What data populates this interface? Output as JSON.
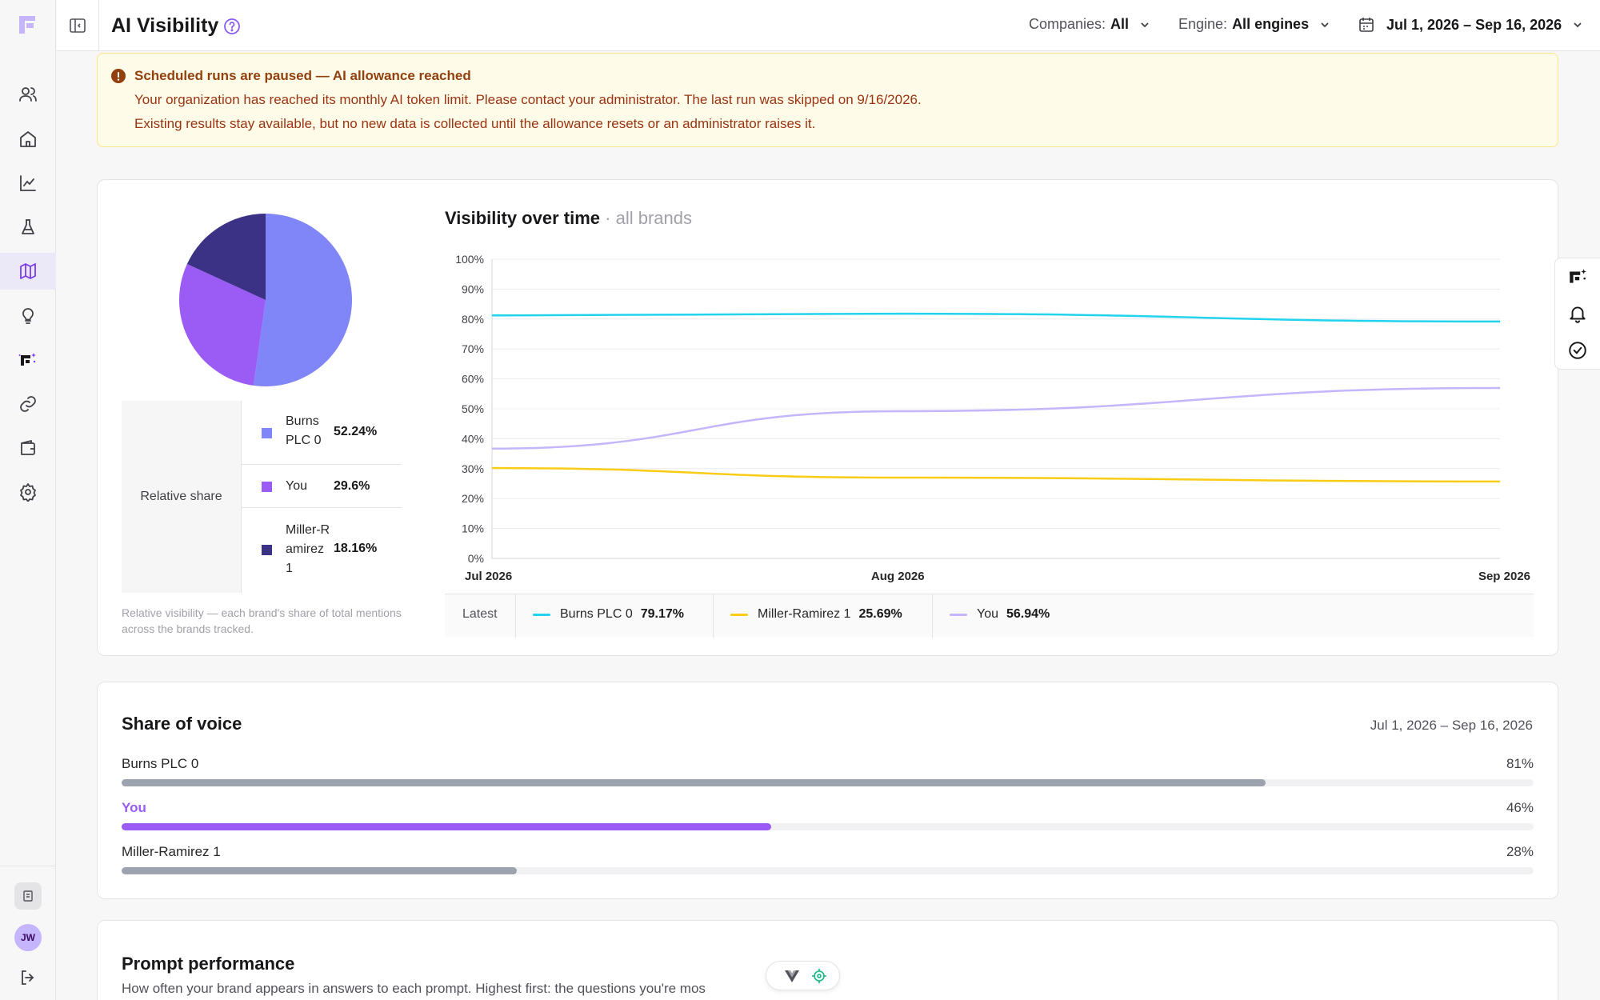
{
  "header": {
    "title": "AI Visibility",
    "companies_label": "Companies:",
    "companies_value": "All",
    "engine_label": "Engine:",
    "engine_value": "All engines",
    "date_range": "Jul 1, 2026 – Sep 16, 2026"
  },
  "alert": {
    "title": "Scheduled runs are paused — AI allowance reached",
    "line1": "Your organization has reached its monthly AI token limit. Please contact your administrator. The last run was skipped on 9/16/2026.",
    "line2": "Existing results stay available, but no new data is collected until the allowance resets or an administrator raises it."
  },
  "relative_share": {
    "label": "Relative share",
    "items": [
      {
        "name": "Burns PLC 0",
        "pct": "52.24%",
        "value": 52.24,
        "color": "#8085f8"
      },
      {
        "name": "You",
        "pct": "29.6%",
        "value": 29.6,
        "color": "#9b5cf6"
      },
      {
        "name": "Miller-Ramirez 1",
        "pct": "18.16%",
        "value": 18.16,
        "color": "#3b3285"
      }
    ],
    "note": "Relative visibility — each brand's share of total mentions across the brands tracked."
  },
  "visibility": {
    "title": "Visibility over time",
    "subtitle": "· all brands",
    "latest_label": "Latest",
    "legend": [
      {
        "name": "Burns PLC 0",
        "value": "79.17%",
        "color": "#22d3ee"
      },
      {
        "name": "Miller-Ramirez 1",
        "value": "25.69%",
        "color": "#facc15"
      },
      {
        "name": "You",
        "value": "56.94%",
        "color": "#c4b5fd"
      }
    ]
  },
  "chart_data": {
    "type": "line",
    "title": "Visibility over time",
    "xlabel": "",
    "ylabel": "",
    "x_ticks": [
      "Jul 2026",
      "Aug 2026",
      "Sep 2026"
    ],
    "x": [
      "2026-07-01",
      "2026-08-01",
      "2026-09-16"
    ],
    "y_ticks": [
      "0%",
      "10%",
      "20%",
      "30%",
      "40%",
      "50%",
      "60%",
      "70%",
      "80%",
      "90%",
      "100%"
    ],
    "ylim": [
      0,
      100
    ],
    "grid": true,
    "series": [
      {
        "name": "Burns PLC 0",
        "color": "#22d3ee",
        "values": [
          81.2,
          81.8,
          79.17
        ]
      },
      {
        "name": "Miller-Ramirez 1",
        "color": "#facc15",
        "values": [
          30.2,
          27.0,
          25.69
        ]
      },
      {
        "name": "You",
        "color": "#c4b5fd",
        "values": [
          36.7,
          49.2,
          56.94
        ]
      }
    ]
  },
  "share_of_voice": {
    "title": "Share of voice",
    "date_range": "Jul 1, 2026 – Sep 16, 2026",
    "rows": [
      {
        "name": "Burns PLC 0",
        "pct": "81%",
        "value": 81,
        "color": "#9ca3af"
      },
      {
        "name": "You",
        "pct": "46%",
        "value": 46,
        "color": "#9b5cf6"
      },
      {
        "name": "Miller-Ramirez 1",
        "pct": "28%",
        "value": 28,
        "color": "#9ca3af"
      }
    ]
  },
  "prompt_performance": {
    "title": "Prompt performance",
    "description": "How often your brand appears in answers to each prompt. Highest first: the questions you're mos"
  },
  "user": {
    "initials": "JW"
  }
}
